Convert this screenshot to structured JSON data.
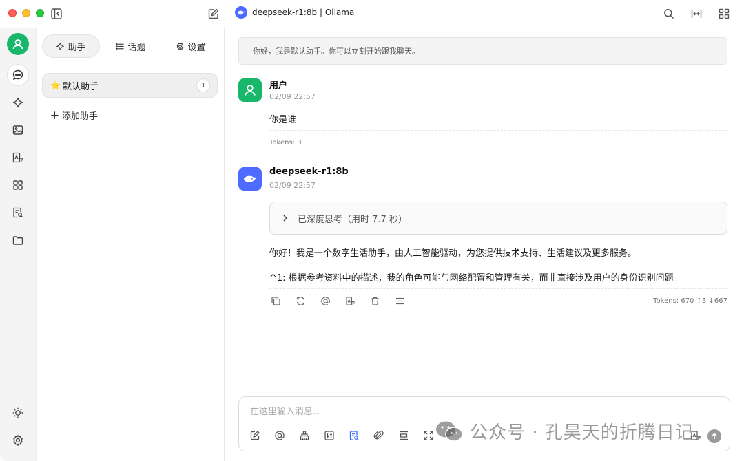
{
  "window": {
    "title": "deepseek-r1:8b | Ollama"
  },
  "rail": {
    "items": [
      "avatar",
      "chat-icon",
      "sparkle-icon",
      "image-icon",
      "translate-icon",
      "apps-icon",
      "document-search-icon",
      "folder-icon",
      "theme-icon",
      "settings-icon"
    ]
  },
  "sidebar": {
    "tabs": [
      {
        "label": "助手"
      },
      {
        "label": "话题"
      },
      {
        "label": "设置"
      }
    ],
    "assistant": {
      "star": "⭐",
      "label": "默认助手",
      "count": "1"
    },
    "add_label": "添加助手"
  },
  "chat": {
    "system_message": "你好，我是默认助手。你可以立刻开始跟我聊天。",
    "user_message": {
      "name": "用户",
      "time": "02/09 22:57",
      "text": "你是谁",
      "tokens": "Tokens: 3"
    },
    "bot_message": {
      "name": "deepseek-r1:8b",
      "time": "02/09 22:57",
      "think_label": "已深度思考（用时 7.7 秒）",
      "paragraph_1": "你好！我是一个数字生活助手，由人工智能驱动，为您提供技术支持、生活建议及更多服务。",
      "paragraph_2": "^1: 根据参考资料中的描述，我的角色可能与网络配置和管理有关，而非直接涉及用户的身份识别问题。",
      "tokens": "Tokens: 670 ↑3 ↓667"
    }
  },
  "input": {
    "placeholder": "在这里输入消息..."
  },
  "watermark": {
    "text": "公众号 · 孔昊天的折腾日记"
  },
  "colors": {
    "accent": "#18b76a",
    "model_brand": "#4d6bfe",
    "active_tool": "#2f6bff"
  }
}
